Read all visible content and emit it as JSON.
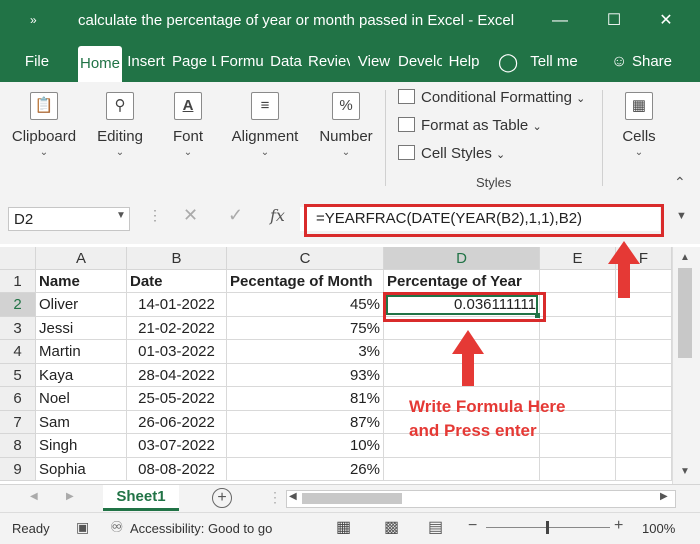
{
  "window": {
    "title": "calculate the percentage of year or month passed in Excel  -  Excel",
    "controls": [
      "—",
      "☐",
      "✕"
    ]
  },
  "tabs": [
    "File",
    "Home",
    "Insert",
    "Page L",
    "Formu",
    "Data",
    "Reviev",
    "View",
    "Develo",
    "Help",
    "Tell me",
    "Share"
  ],
  "ribbon": {
    "clipboard": "Clipboard",
    "editing": "Editing",
    "font": "Font",
    "alignment": "Alignment",
    "number": "Number",
    "conditional_formatting": "Conditional Formatting",
    "format_as_table": "Format as Table",
    "cell_styles": "Cell Styles",
    "styles_group": "Styles",
    "cells": "Cells",
    "font_icon_letter": "A",
    "number_icon": "%"
  },
  "formula_bar": {
    "name_box": "D2",
    "fx": "fx",
    "formula": "=YEARFRAC(DATE(YEAR(B2),1,1),B2)"
  },
  "columns": [
    "A",
    "B",
    "C",
    "D",
    "E",
    "F"
  ],
  "rows": [
    "1",
    "2",
    "3",
    "4",
    "5",
    "6",
    "7",
    "8",
    "9"
  ],
  "table": {
    "headers": [
      "Name",
      "Date",
      "Pecentage of Month",
      "Percentage of Year"
    ],
    "data": [
      [
        "Oliver",
        "14-01-2022",
        "45%",
        "0.036111111"
      ],
      [
        "Jessi",
        "21-02-2022",
        "75%",
        ""
      ],
      [
        "Martin",
        "01-03-2022",
        "3%",
        ""
      ],
      [
        "Kaya",
        "28-04-2022",
        "93%",
        ""
      ],
      [
        "Noel",
        "25-05-2022",
        "81%",
        ""
      ],
      [
        "Sam",
        "26-06-2022",
        "87%",
        ""
      ],
      [
        "Singh",
        "03-07-2022",
        "10%",
        ""
      ],
      [
        "Sophia",
        "08-08-2022",
        "26%",
        ""
      ]
    ]
  },
  "annotation": {
    "line1": "Write Formula Here",
    "line2": "and Press enter",
    "color": "#e53935"
  },
  "sheet_tab": "Sheet1",
  "status": {
    "ready": "Ready",
    "accessibility": "Accessibility: Good to go",
    "zoom": "100%"
  },
  "colors": {
    "excel_green": "#217346",
    "annotation_red": "#d92b2b"
  }
}
